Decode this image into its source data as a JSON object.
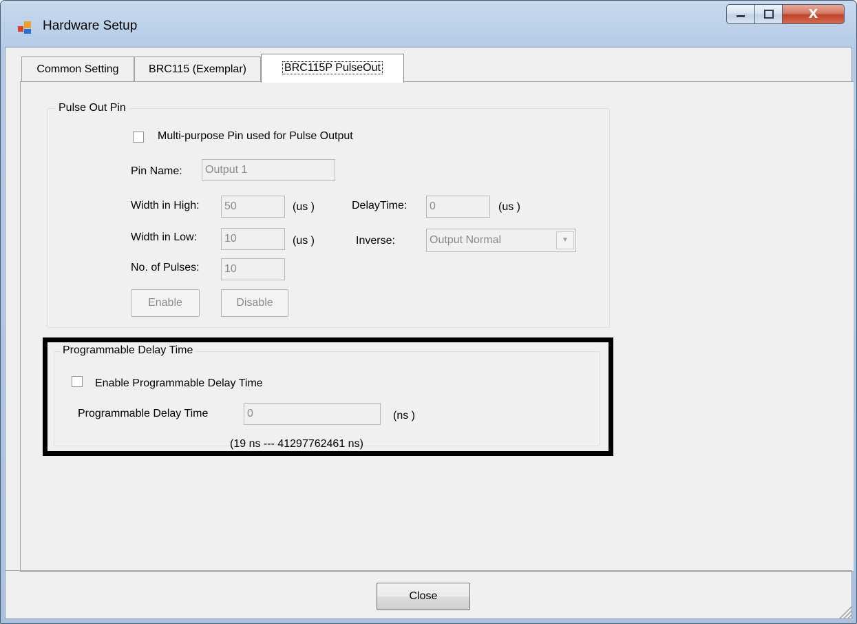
{
  "window": {
    "title": "Hardware Setup",
    "controls": {
      "minimize_icon": "minimize-icon",
      "maximize_icon": "maximize-icon",
      "close_icon": "close-icon",
      "close_glyph": "X"
    }
  },
  "tabs": [
    {
      "label": "Common Setting",
      "selected": false
    },
    {
      "label": "BRC115 (Exemplar)",
      "selected": false
    },
    {
      "label": "BRC115P PulseOut",
      "selected": true
    }
  ],
  "pulse_out": {
    "legend": "Pulse Out Pin",
    "multi_purpose_label": "Multi-purpose Pin used for Pulse Output",
    "multi_purpose_checked": false,
    "pin_name_label": "Pin Name:",
    "pin_name_value": "Output 1",
    "width_high_label": "Width in High:",
    "width_high_value": "50",
    "width_high_unit": "(us )",
    "delay_time_label": "DelayTime:",
    "delay_time_value": "0",
    "delay_time_unit": "(us )",
    "width_low_label": "Width in Low:",
    "width_low_value": "10",
    "width_low_unit": "(us )",
    "inverse_label": "Inverse:",
    "inverse_value": "Output Normal",
    "pulses_label": "No. of Pulses:",
    "pulses_value": "10",
    "enable_label": "Enable",
    "disable_label": "Disable"
  },
  "programmable_delay": {
    "legend": "Programmable Delay Time",
    "enable_label": "Enable Programmable Delay Time",
    "enable_checked": false,
    "delay_label": "Programmable Delay Time",
    "delay_value": "0",
    "delay_unit": "(ns )",
    "range_text": "(19 ns --- 41297762461 ns)"
  },
  "footer": {
    "close_label": "Close"
  },
  "colors": {
    "title_bar": "#b4cbe6",
    "close_button": "#c0442b",
    "highlight_frame": "#000000"
  }
}
